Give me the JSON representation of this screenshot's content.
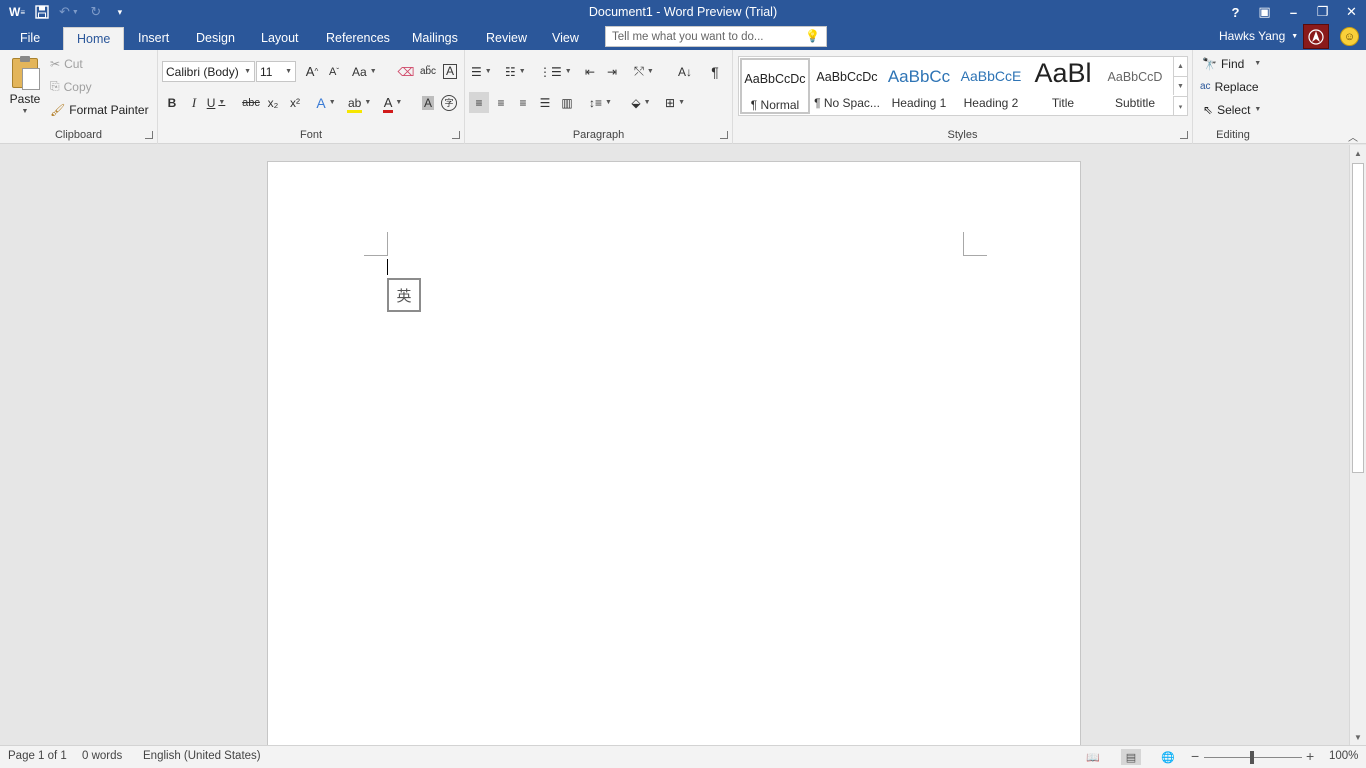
{
  "app": {
    "title": "Document1 - Word Preview (Trial)"
  },
  "qat": {
    "app_icon": "word-icon",
    "save_icon": "save-icon",
    "undo_icon": "undo-icon",
    "redo_icon": "redo-icon",
    "customize_icon": "customize-qat-icon"
  },
  "window_controls": {
    "help": "?",
    "ribbon_display": "▣",
    "minimize": "–",
    "restore": "❐",
    "close": "✕"
  },
  "tabs": [
    "File",
    "Home",
    "Insert",
    "Design",
    "Layout",
    "References",
    "Mailings",
    "Review",
    "View"
  ],
  "active_tab": "Home",
  "tell_me": {
    "placeholder": "Tell me what you want to do..."
  },
  "user": {
    "name": "Hawks Yang"
  },
  "clipboard": {
    "paste": "Paste",
    "cut": "Cut",
    "copy": "Copy",
    "format_painter": "Format Painter",
    "group_label": "Clipboard"
  },
  "font": {
    "family": "Calibri (Body)",
    "size": "11",
    "grow": "A",
    "shrink": "A",
    "change_case": "Aa",
    "bold": "B",
    "italic": "I",
    "underline": "U",
    "strikethrough": "abc",
    "subscript": "x₂",
    "superscript": "x²",
    "text_effects": "A",
    "highlight": "ab",
    "font_color": "A",
    "shading": "A",
    "enclose": "字",
    "group_label": "Font",
    "highlight_color": "#f6e600",
    "font_color_value": "#d11a1a"
  },
  "paragraph": {
    "group_label": "Paragraph",
    "show_marks": "¶"
  },
  "styles": {
    "group_label": "Styles",
    "items": [
      {
        "sample": "AaBbCcDc",
        "name": "¶ Normal"
      },
      {
        "sample": "AaBbCcDc",
        "name": "¶ No Spac..."
      },
      {
        "sample": "AaBbCc",
        "name": "Heading 1"
      },
      {
        "sample": "AaBbCcE",
        "name": "Heading 2"
      },
      {
        "sample": "AaBl",
        "name": "Title"
      },
      {
        "sample": "AaBbCcD",
        "name": "Subtitle"
      }
    ]
  },
  "editing": {
    "find": "Find",
    "replace": "Replace",
    "select": "Select",
    "group_label": "Editing"
  },
  "document": {
    "ime_indicator": "英"
  },
  "status": {
    "page": "Page 1 of 1",
    "words": "0 words",
    "language": "English (United States)",
    "zoom": "100%"
  },
  "colors": {
    "accent": "#2b579a",
    "ribbon_bg": "#f3f3f3",
    "workspace_bg": "#e6e6e6"
  }
}
